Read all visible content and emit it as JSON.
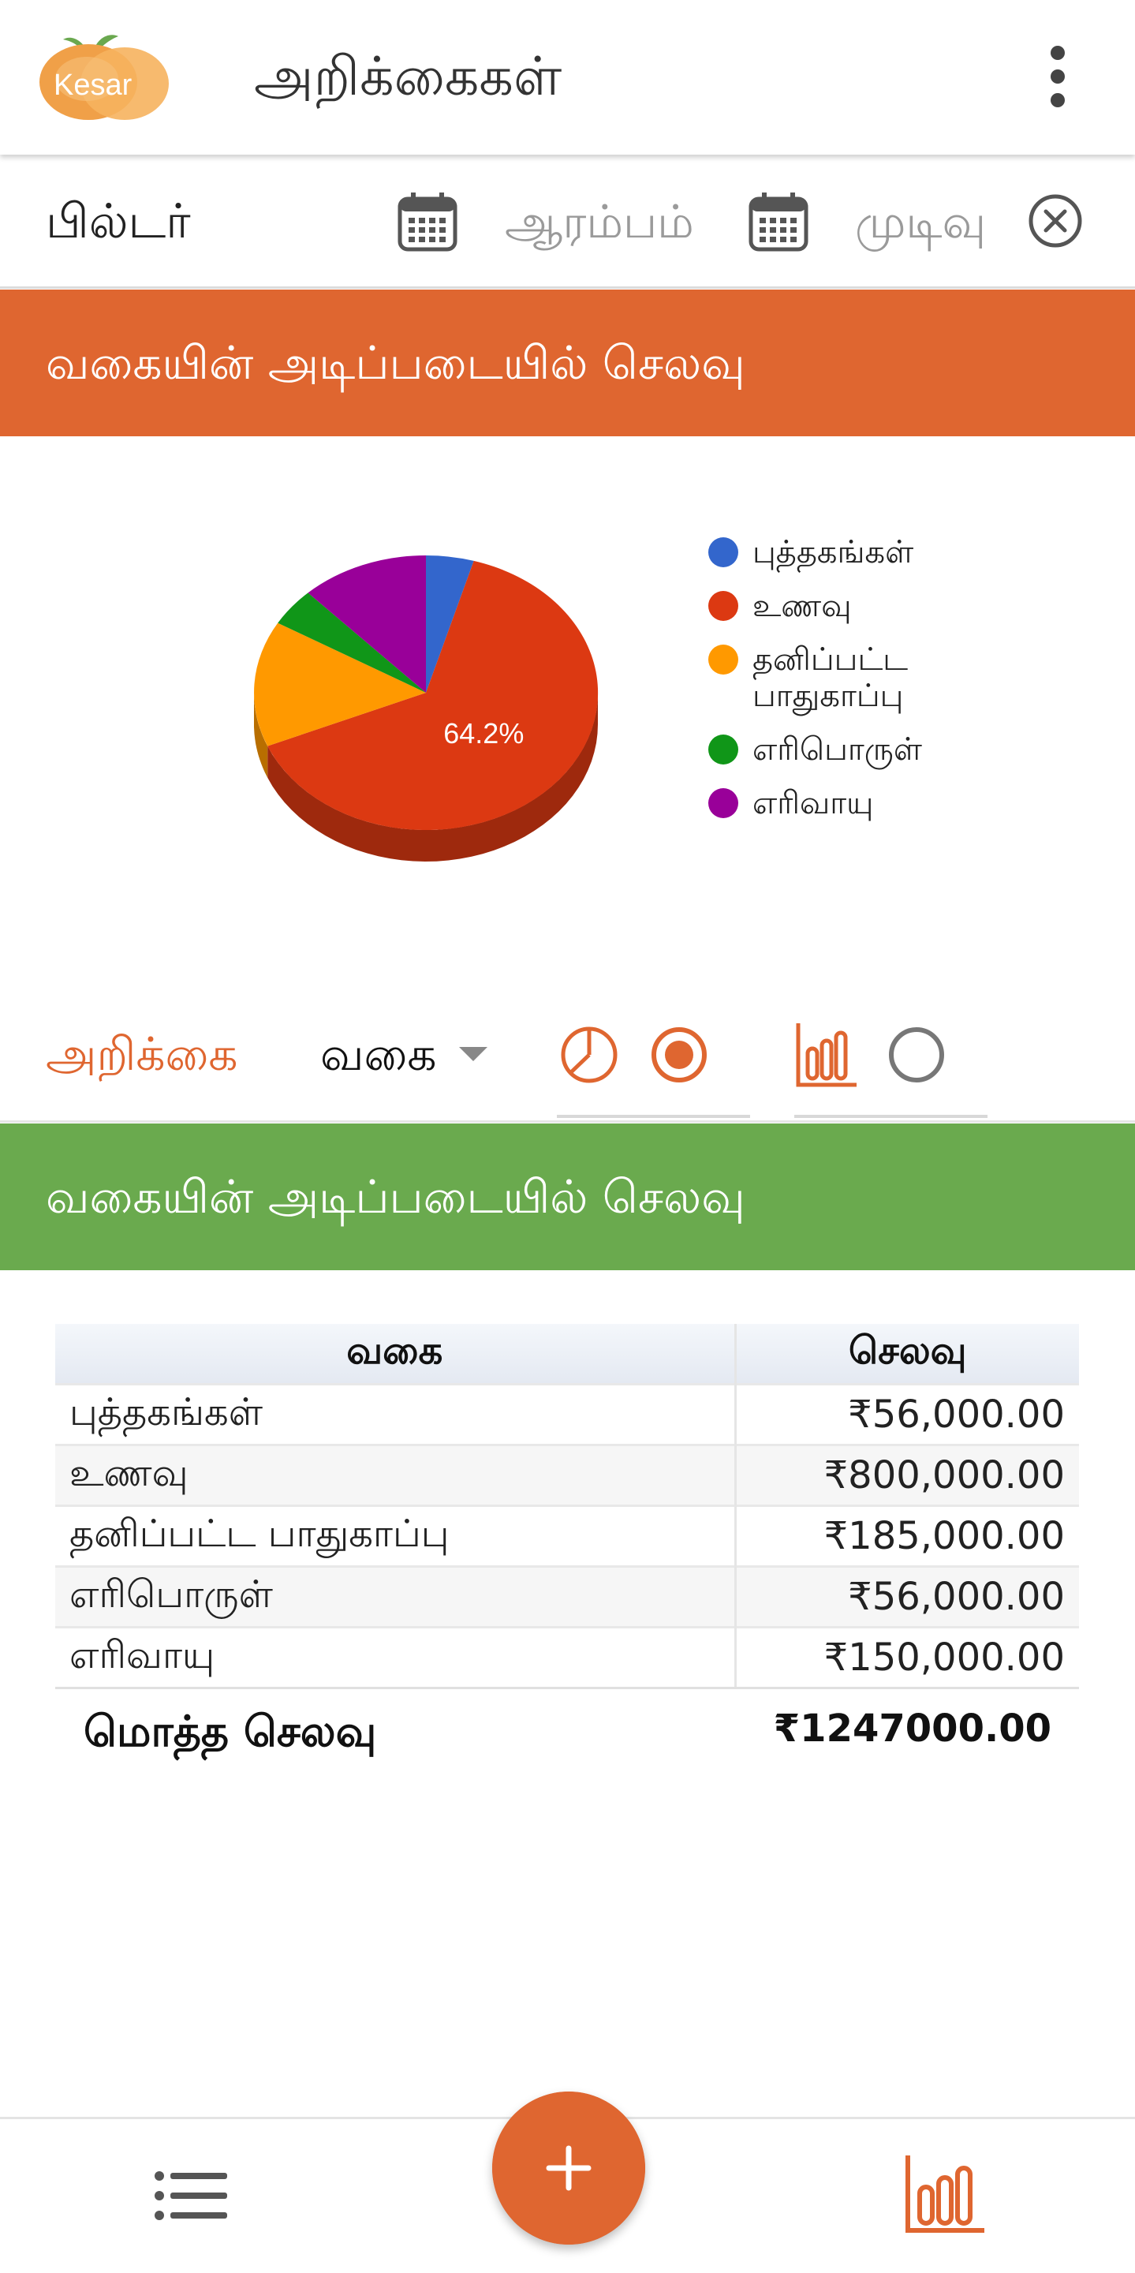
{
  "app_bar": {
    "logo_text": "Kesar",
    "title": "அறிக்கைகள்",
    "menu_icon": "more-vert-icon"
  },
  "filter": {
    "label": "பில்டர்",
    "start_placeholder": "ஆரம்பம்",
    "end_placeholder": "முடிவு",
    "calendar_icon": "calendar-icon",
    "clear_icon": "close-circle-icon"
  },
  "chart_section": {
    "title": "வகையின் அடிப்படையில் செலவு"
  },
  "chart_data": {
    "type": "pie",
    "title": "",
    "categories": [
      "புத்தகங்கள்",
      "உணவு",
      "தனிப்பட்ட பாதுகாப்பு",
      "எரிபொருள்",
      "எரிவாயு"
    ],
    "values": [
      56000,
      800000,
      185000,
      56000,
      150000
    ],
    "colors": [
      "#3366cc",
      "#dc3912",
      "#ff9900",
      "#109618",
      "#990099"
    ],
    "data_labels": [
      "",
      "64.2%",
      "",
      "",
      ""
    ],
    "legend": [
      "புத்தகங்கள்",
      "உணவு",
      "தனிப்பட்ட பாதுகாப்பு",
      "எரிபொருள்",
      "எரிவாயு"
    ],
    "legend_position": "right",
    "style": "3d"
  },
  "selector": {
    "report_label": "அறிக்கை",
    "type_value": "வகை",
    "pie_option_selected": true,
    "bar_option_selected": false
  },
  "table_section": {
    "title": "வகையின் அடிப்படையில் செலவு",
    "headers": [
      "வகை",
      "செலவு"
    ],
    "rows": [
      {
        "category": "புத்தகங்கள்",
        "amount": "₹56,000.00"
      },
      {
        "category": "உணவு",
        "amount": "₹800,000.00"
      },
      {
        "category": "தனிப்பட்ட பாதுகாப்பு",
        "amount": "₹185,000.00"
      },
      {
        "category": "எரிபொருள்",
        "amount": "₹56,000.00"
      },
      {
        "category": "எரிவாயு",
        "amount": "₹150,000.00"
      }
    ],
    "total_label": "மொத்த செலவு",
    "total_value": "₹1247000.00"
  },
  "bottom_nav": {
    "list_icon": "list-icon",
    "add_icon": "plus-icon",
    "chart_icon": "bar-chart-icon",
    "accent": "#df6630"
  }
}
